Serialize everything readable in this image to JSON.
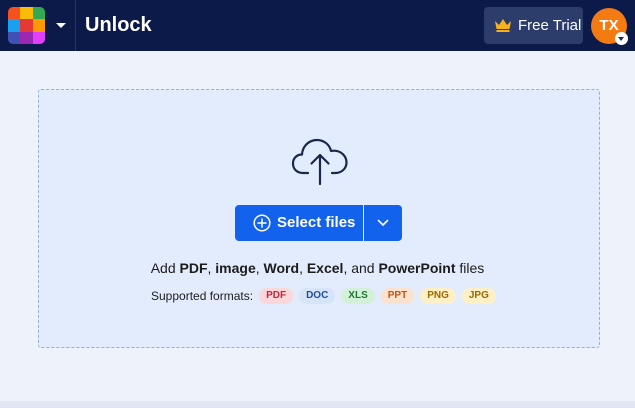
{
  "header": {
    "title": "Unlock",
    "trial_label": "Free Trial",
    "avatar_initials": "TX",
    "logo_colors": [
      "#f4511e",
      "#fbbc05",
      "#34a853",
      "#1aa0f0",
      "#e53935",
      "#ff9800",
      "#3f51b5",
      "#9c27b0",
      "#e040fb"
    ],
    "crown_color": "#f6b21b"
  },
  "upload": {
    "select_label": "Select files",
    "add_prefix": "Add ",
    "add_pdf": "PDF",
    "comma1": ", ",
    "add_image": "image",
    "comma2": ", ",
    "add_word": "Word",
    "comma3": ", ",
    "add_excel": "Excel",
    "add_and": ", and ",
    "add_ppt": "PowerPoint",
    "add_suffix": " files",
    "formats_label": "Supported formats:",
    "formats": [
      {
        "label": "PDF",
        "bg": "#fbd7dc",
        "fg": "#c0283a"
      },
      {
        "label": "DOC",
        "bg": "#d6e4f8",
        "fg": "#1e4f9c"
      },
      {
        "label": "XLS",
        "bg": "#d3f0d8",
        "fg": "#1d7a34"
      },
      {
        "label": "PPT",
        "bg": "#fbe2cc",
        "fg": "#c2541a"
      },
      {
        "label": "PNG",
        "bg": "#fdf0c6",
        "fg": "#9a6b00"
      },
      {
        "label": "JPG",
        "bg": "#fdf0c6",
        "fg": "#9a6b00"
      }
    ]
  }
}
